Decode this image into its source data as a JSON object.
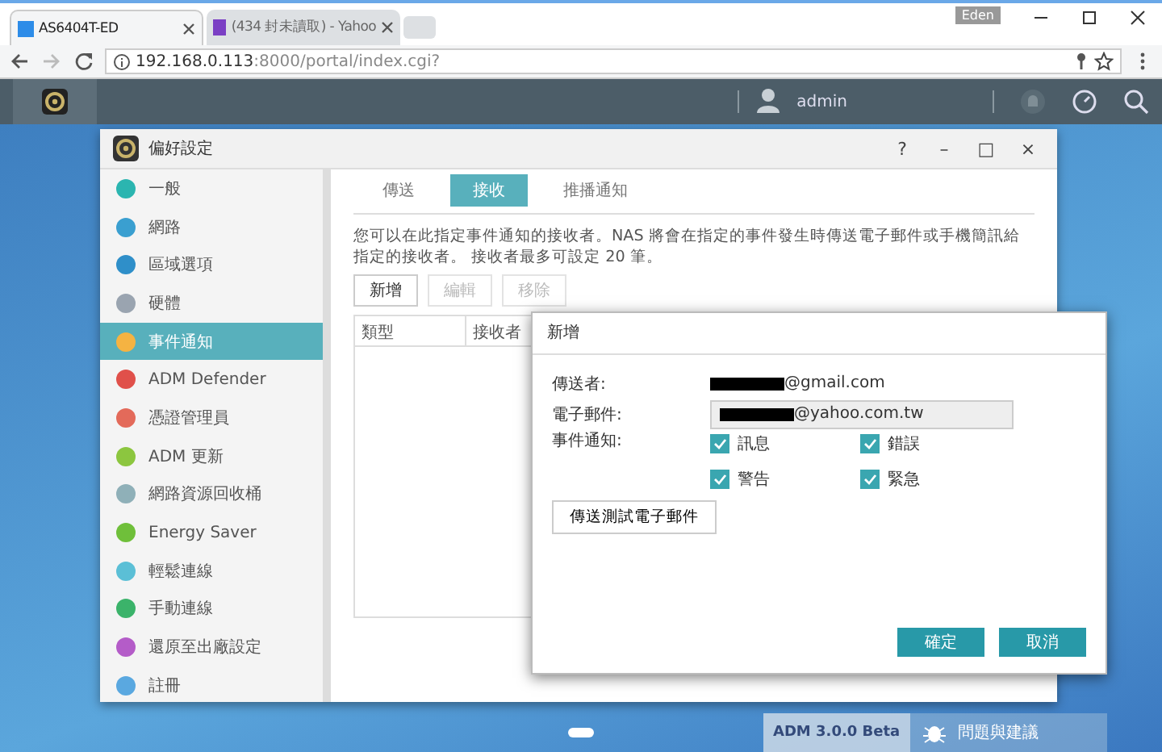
{
  "browser": {
    "tabs": [
      {
        "title": "AS6404T-ED",
        "selected": true
      },
      {
        "title": "(434 封未讀取) - Yahoo",
        "selected": false
      }
    ],
    "user_badge": "Eden",
    "url_host": "192.168.0.113",
    "url_rest": ":8000/portal/index.cgi?"
  },
  "topbar": {
    "user": "admin"
  },
  "window": {
    "title": "偏好設定",
    "controls": [
      "?",
      "–",
      "□",
      "×"
    ]
  },
  "sidebar": {
    "items": [
      {
        "label": "一般",
        "color": "#2bb5b0",
        "selected": false
      },
      {
        "label": "網路",
        "color": "#3a9fd0",
        "selected": false
      },
      {
        "label": "區域選項",
        "color": "#2f8fc9",
        "selected": false
      },
      {
        "label": "硬體",
        "color": "#9aa4b0",
        "selected": false
      },
      {
        "label": "事件通知",
        "color": "#f5b342",
        "selected": true
      },
      {
        "label": "ADM Defender",
        "color": "#e0504a",
        "selected": false
      },
      {
        "label": "憑證管理員",
        "color": "#e36a5a",
        "selected": false
      },
      {
        "label": "ADM 更新",
        "color": "#8cc63f",
        "selected": false
      },
      {
        "label": "網路資源回收桶",
        "color": "#8fb0b8",
        "selected": false
      },
      {
        "label": "Energy Saver",
        "color": "#6fbf3a",
        "selected": false
      },
      {
        "label": "輕鬆連線",
        "color": "#5bbfd6",
        "selected": false
      },
      {
        "label": "手動連線",
        "color": "#3bb36a",
        "selected": false
      },
      {
        "label": "還原至出廠設定",
        "color": "#b45cc8",
        "selected": false
      },
      {
        "label": "註冊",
        "color": "#5aa8e0",
        "selected": false
      }
    ]
  },
  "tabs": [
    {
      "label": "傳送",
      "selected": false
    },
    {
      "label": "接收",
      "selected": true
    },
    {
      "label": "推播通知",
      "selected": false
    }
  ],
  "description": "您可以在此指定事件通知的接收者。NAS 將會在指定的事件發生時傳送電子郵件或手機簡訊給指定的接收者。 接收者最多可設定 20 筆。",
  "toolbar": [
    {
      "label": "新增",
      "disabled": false
    },
    {
      "label": "編輯",
      "disabled": true
    },
    {
      "label": "移除",
      "disabled": true
    }
  ],
  "table": {
    "columns": [
      "類型",
      "接收者"
    ]
  },
  "dialog": {
    "title": "新增",
    "sender_label": "傳送者:",
    "sender": "@gmail.com",
    "email_label": "電子郵件:",
    "email": "@yahoo.com.tw",
    "events_label": "事件通知:",
    "events": [
      {
        "label": "訊息",
        "checked": true
      },
      {
        "label": "錯誤",
        "checked": true
      },
      {
        "label": "警告",
        "checked": true
      },
      {
        "label": "緊急",
        "checked": true
      }
    ],
    "test_button": "傳送測試電子郵件",
    "ok": "確定",
    "cancel": "取消"
  },
  "bottom": {
    "version": "ADM 3.0.0 Beta",
    "feedback": "問題與建議"
  }
}
